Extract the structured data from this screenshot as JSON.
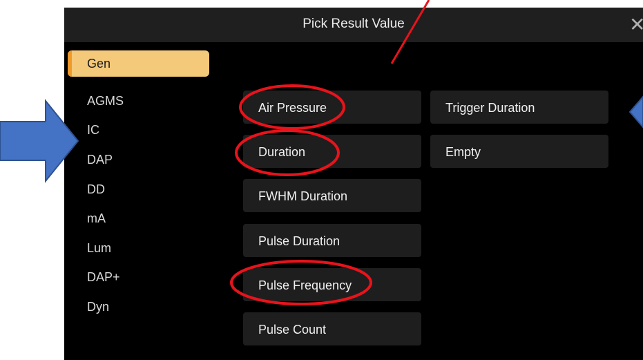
{
  "dialog": {
    "title": "Pick Result Value",
    "close_glyph": "✕",
    "tabs": [
      {
        "label": "Gen",
        "active": true
      },
      {
        "label": "AGMS"
      },
      {
        "label": "IC"
      },
      {
        "label": "DAP"
      },
      {
        "label": "DD"
      },
      {
        "label": "mA"
      },
      {
        "label": "Lum"
      },
      {
        "label": "DAP+"
      },
      {
        "label": "Dyn"
      }
    ],
    "options_col1": [
      "Air Pressure",
      "Duration",
      "FWHM Duration",
      "Pulse Duration",
      "Pulse Frequency",
      "Pulse Count"
    ],
    "options_col2": [
      "Trigger Duration",
      "Empty"
    ]
  },
  "annotations": {
    "circle_color": "#e8131b",
    "arrow_color": "#4472c4",
    "line_color": "#e8131b"
  }
}
